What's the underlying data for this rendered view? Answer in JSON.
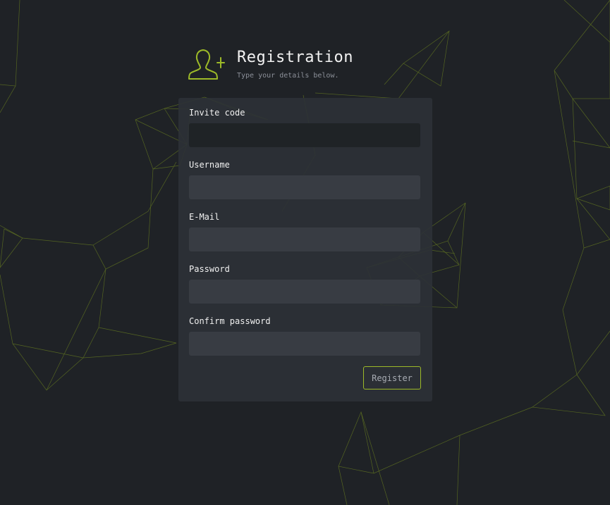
{
  "header": {
    "title": "Registration",
    "subtitle": "Type your details below.",
    "icon": "add-user-icon"
  },
  "form": {
    "fields": [
      {
        "label": "Invite code",
        "value": "",
        "placeholder": ""
      },
      {
        "label": "Username",
        "value": "",
        "placeholder": ""
      },
      {
        "label": "E-Mail",
        "value": "",
        "placeholder": ""
      },
      {
        "label": "Password",
        "value": "",
        "placeholder": ""
      },
      {
        "label": "Confirm password",
        "value": "",
        "placeholder": ""
      }
    ],
    "submit_label": "Register"
  },
  "colors": {
    "accent": "#9dba28",
    "background": "#1f2226",
    "card": "#2d3136",
    "input": "#383c43",
    "input_focused": "#1f2326"
  }
}
